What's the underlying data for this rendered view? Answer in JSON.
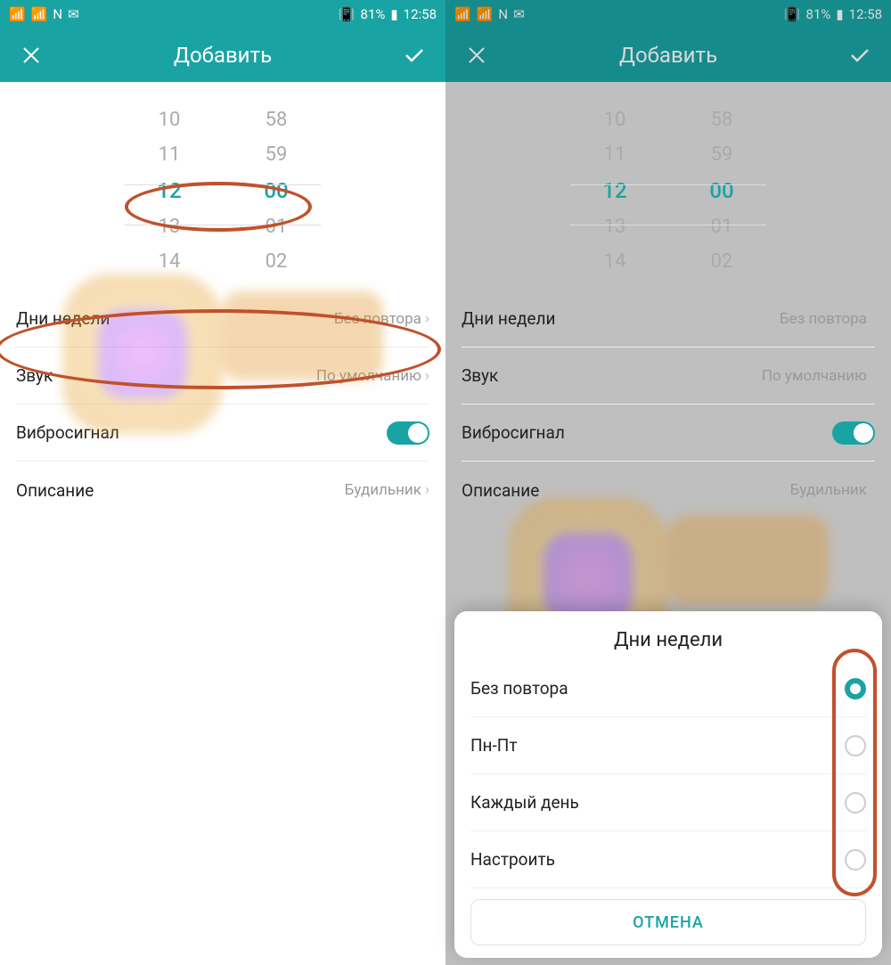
{
  "statusbar": {
    "battery": "81%",
    "time": "12:58",
    "nfc": "N",
    "vibrate_icon": "vibrate"
  },
  "header": {
    "title": "Добавить"
  },
  "timepicker": {
    "hours": [
      "10",
      "11",
      "12",
      "13",
      "14"
    ],
    "minutes": [
      "58",
      "59",
      "00",
      "01",
      "02"
    ],
    "selected_hour": "12",
    "selected_minute": "00"
  },
  "settings": {
    "days": {
      "label": "Дни недели",
      "value": "Без повтора"
    },
    "sound": {
      "label": "Звук",
      "value": "По умолчанию"
    },
    "vibrate": {
      "label": "Вибросигнал",
      "on": true
    },
    "description": {
      "label": "Описание",
      "value": "Будильник"
    }
  },
  "sheet": {
    "title": "Дни недели",
    "options": [
      {
        "label": "Без повтора",
        "selected": true
      },
      {
        "label": "Пн-Пт",
        "selected": false
      },
      {
        "label": "Каждый день",
        "selected": false
      },
      {
        "label": "Настроить",
        "selected": false
      }
    ],
    "cancel": "ОТМЕНА"
  }
}
